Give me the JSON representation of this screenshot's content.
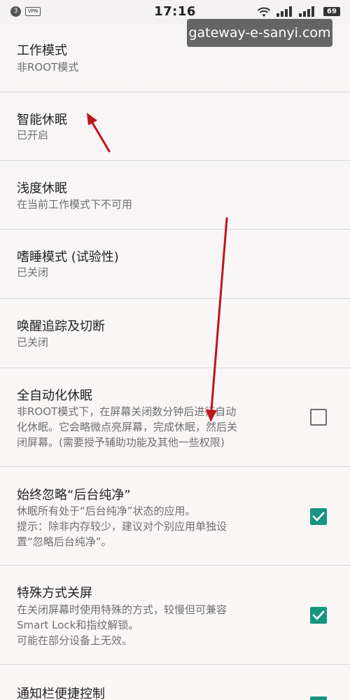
{
  "status_bar": {
    "notification_count": "3",
    "vpn_label": "VPN",
    "time": "17:16",
    "battery": "69"
  },
  "watermark": "gateway-e-sanyi.com",
  "settings": [
    {
      "title": "工作模式",
      "summary_lines": [
        "非ROOT模式"
      ]
    },
    {
      "title": "智能休眠",
      "summary_lines": [
        "已开启"
      ]
    },
    {
      "title": "浅度休眠",
      "summary_lines": [
        "在当前工作模式下不可用"
      ]
    },
    {
      "title": "嗜睡模式 (试验性)",
      "summary_lines": [
        "已关闭"
      ]
    },
    {
      "title": "唤醒追踪及切断",
      "summary_lines": [
        "已关闭"
      ]
    },
    {
      "title": "全自动化休眠",
      "summary_lines": [
        "非ROOT模式下，在屏幕关闭数分钟后进行自动",
        "化休眠。它会略微点亮屏幕，完成休眠，然后关",
        "闭屏幕。(需要授予辅助功能及其他一些权限)"
      ],
      "checked": false
    },
    {
      "title": "始终忽略“后台纯净”",
      "summary_lines": [
        "休眠所有处于“后台纯净”状态的应用。",
        "提示：除非内存较少，建议对个别应用单独设",
        "置“忽略后台纯净”。"
      ],
      "checked": true
    },
    {
      "title": "特殊方式关屏",
      "summary_lines": [
        "在关闭屏幕时使用特殊的方式，较慢但可兼容",
        "Smart Lock和指纹解锁。",
        "可能在部分设备上无效。"
      ],
      "checked": true
    },
    {
      "title": "通知栏便捷控制",
      "summary_lines": [],
      "checked": true
    }
  ],
  "colors": {
    "checkbox_checked": "#17957e",
    "annotation_arrow": "#c0141a",
    "divider": "#d6dbe0"
  }
}
